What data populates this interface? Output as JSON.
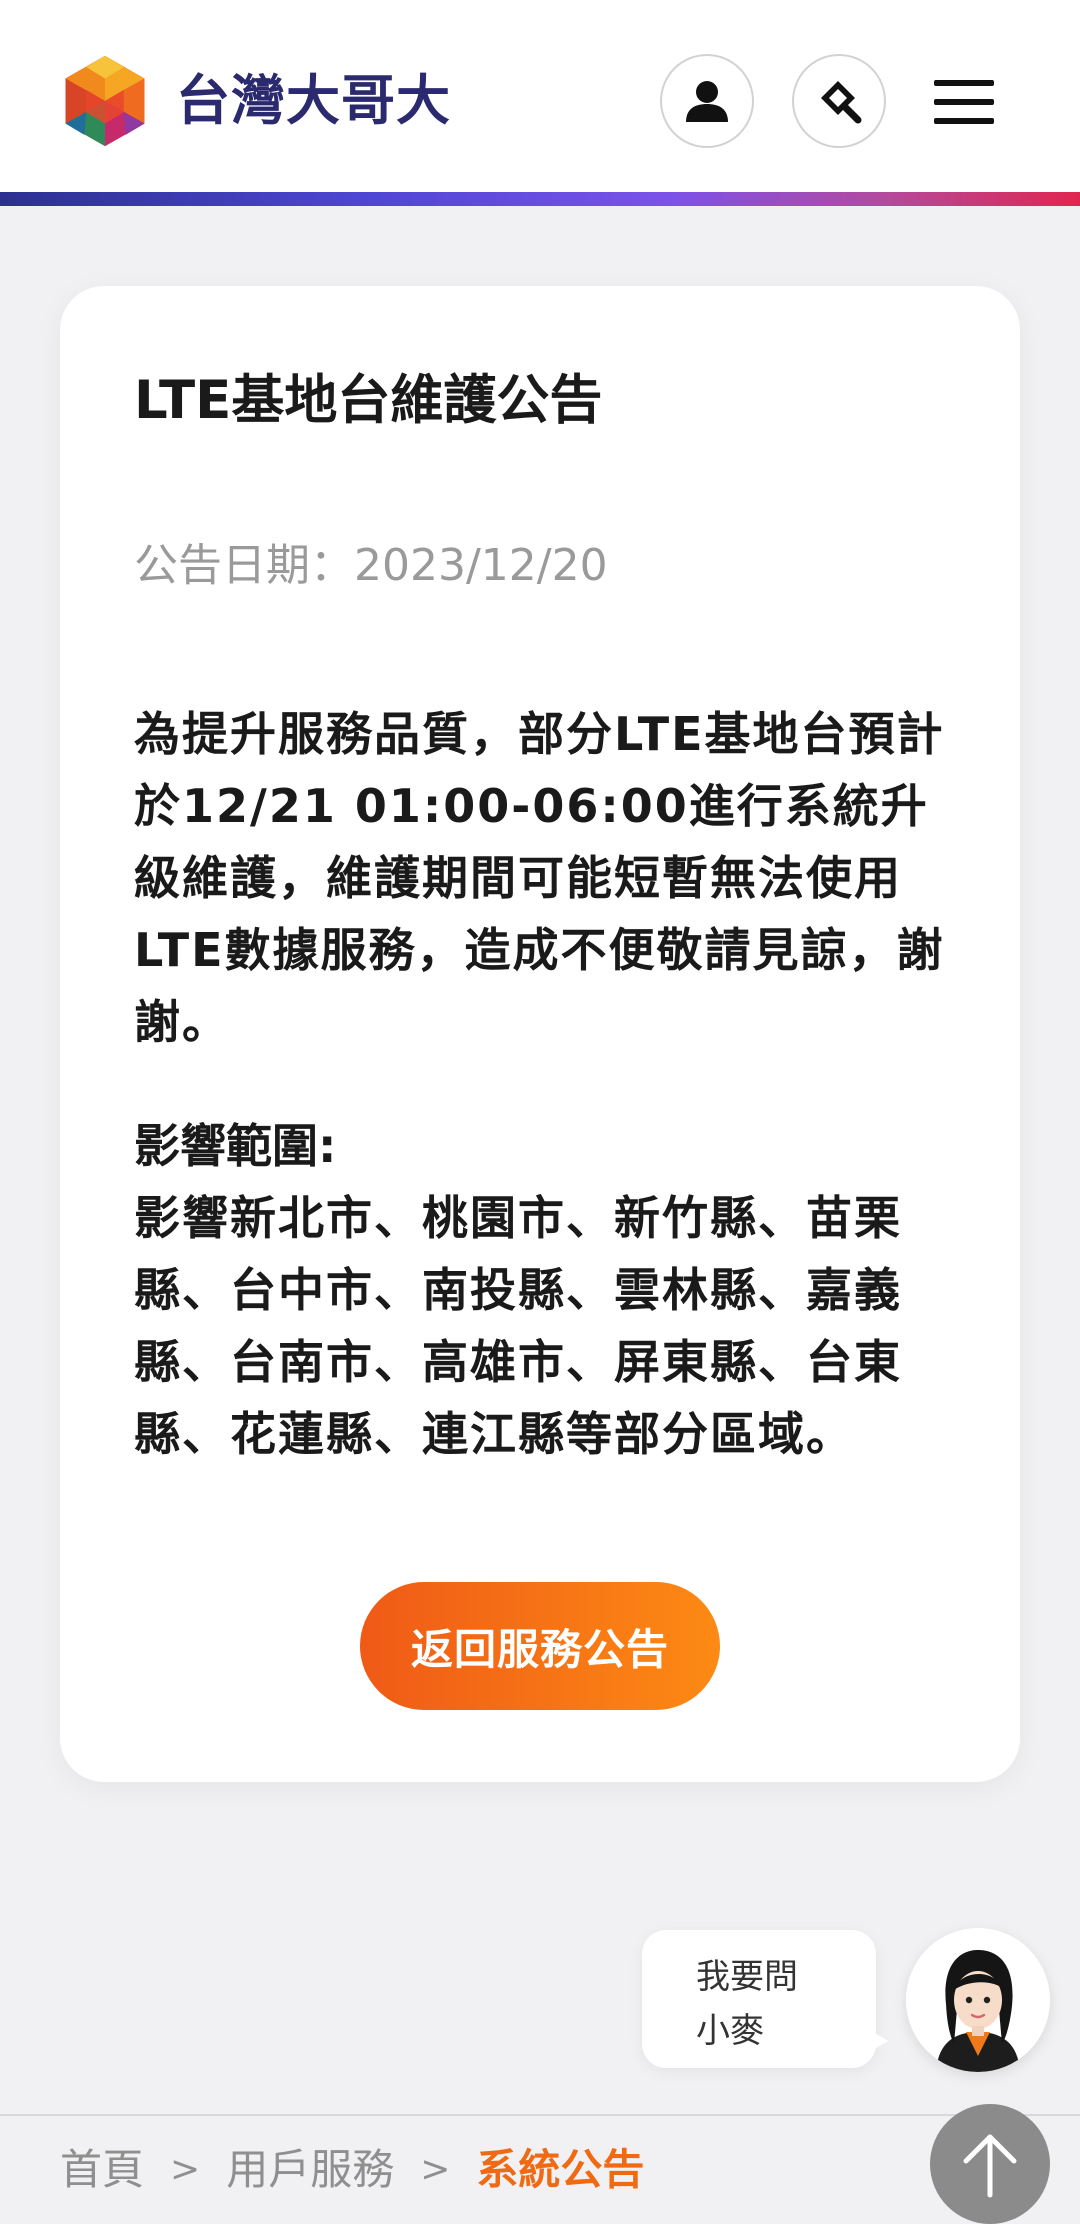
{
  "header": {
    "brand": "台灣大哥大",
    "user_icon": "user-icon",
    "search_icon": "search-icon",
    "menu_icon": "hamburger-menu-icon"
  },
  "notice": {
    "title": "LTE基地台維護公告",
    "date_label": "公告日期：",
    "date_value": "2023/12/20",
    "body": "為提升服務品質，部分LTE基地台預計於12/21 01:00-06:00進行系統升級維護，維護期間可能短暫無法使用LTE數據服務，造成不便敬請見諒，謝謝。",
    "impact_heading": "影響範圍:",
    "impact_body": "影響新北市、桃園市、新竹縣、苗栗縣、台中市、南投縣、雲林縣、嘉義縣、台南市、高雄市、屏東縣、台東縣、花蓮縣、連江縣等部分區域。",
    "back_button": "返回服務公告"
  },
  "assistant": {
    "line1": "我要問",
    "line2": "小麥"
  },
  "breadcrumb": {
    "home": "首頁",
    "section": "用戶服務",
    "current": "系統公告",
    "separator": ">"
  },
  "colors": {
    "brand_text": "#2b2a6e",
    "accent_orange": "#f06a14",
    "header_gradient": [
      "#2b3190",
      "#7b52ea",
      "#e0264f"
    ]
  }
}
